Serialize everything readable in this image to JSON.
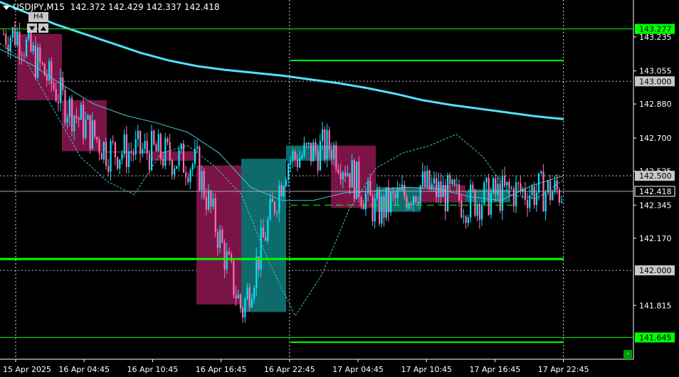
{
  "header": {
    "symbol_line": "USDJPY,M15",
    "ohlc": "142.372 142.429 142.337 142.418"
  },
  "timeframe": {
    "label": "H4"
  },
  "colors": {
    "background": "#000000",
    "bull_candle": "#00e5ff",
    "bear_candle": "#ff6fae",
    "bull_box": "#0f6b6b",
    "bear_box": "#7a1446",
    "ma_slow": "#4fe3ff",
    "ma_fast": "#40c8d0",
    "level_green": "#00ff00",
    "grid": "#c0c0c0"
  },
  "chart_data": {
    "type": "candlestick",
    "title": "USDJPY,M15",
    "ylim": [
      141.53,
      143.43
    ],
    "y_ticks": [
      143.235,
      143.055,
      142.88,
      142.7,
      142.525,
      142.345,
      142.17,
      141.815
    ],
    "x_ticks": [
      "15 Apr 2025",
      "16 Apr 04:45",
      "16 Apr 10:45",
      "16 Apr 16:45",
      "16 Apr 22:45",
      "17 Apr 04:45",
      "17 Apr 10:45",
      "17 Apr 16:45",
      "17 Apr 22:45"
    ],
    "price_labels": [
      {
        "text": "143.277",
        "value": 143.277,
        "style": "green"
      },
      {
        "text": "143.000",
        "value": 143.0,
        "style": "gray"
      },
      {
        "text": "142.500",
        "value": 142.5,
        "style": "gray"
      },
      {
        "text": "142.418",
        "value": 142.418,
        "style": "white"
      },
      {
        "text": "142.000",
        "value": 142.0,
        "style": "gray"
      },
      {
        "text": "141.645",
        "value": 141.645,
        "style": "green"
      }
    ],
    "h4_boxes": [
      {
        "open": 143.25,
        "close": 142.9,
        "dir": "bear"
      },
      {
        "open": 142.9,
        "close": 142.63,
        "dir": "bear"
      },
      {
        "open": 142.63,
        "close": 142.63,
        "dir": "bear"
      },
      {
        "open": 142.63,
        "close": 142.58,
        "dir": "bear"
      },
      {
        "open": 142.555,
        "close": 141.82,
        "dir": "bear"
      },
      {
        "open": 141.78,
        "close": 142.59,
        "dir": "bull"
      },
      {
        "open": 142.58,
        "close": 142.66,
        "dir": "bull"
      },
      {
        "open": 142.66,
        "close": 142.33,
        "dir": "bear"
      },
      {
        "open": 142.31,
        "close": 142.44,
        "dir": "bull"
      },
      {
        "open": 142.45,
        "close": 142.36,
        "dir": "bear"
      },
      {
        "open": 142.36,
        "close": 142.418,
        "dir": "bull"
      }
    ],
    "levels": [
      {
        "value": 143.277,
        "kind": "thin"
      },
      {
        "value": 143.11,
        "kind": "segment"
      },
      {
        "value": 142.06,
        "kind": "thick"
      },
      {
        "value": 141.645,
        "kind": "thin"
      },
      {
        "value": 141.62,
        "kind": "segment"
      },
      {
        "value": 142.345,
        "kind": "dashed"
      }
    ],
    "ma_slow_values": [
      143.42,
      143.36,
      143.3,
      143.25,
      143.2,
      143.15,
      143.11,
      143.08,
      143.06,
      143.045,
      143.03,
      143.01,
      142.99,
      142.965,
      142.935,
      142.9,
      142.875,
      142.855,
      142.835,
      142.815,
      142.8
    ],
    "ma_fast_values": [
      143.17,
      143.09,
      142.98,
      142.88,
      142.82,
      142.78,
      142.73,
      142.62,
      142.44,
      142.37,
      142.37,
      142.41,
      142.42,
      142.44,
      142.43,
      142.39,
      142.37,
      142.45,
      142.5
    ],
    "ma_dashed_values": [
      143.2,
      143.1,
      142.85,
      142.6,
      142.47,
      142.4,
      142.62,
      142.66,
      142.55,
      142.4,
      142.05,
      141.76,
      141.98,
      142.32,
      142.54,
      142.62,
      142.66,
      142.72,
      142.6,
      142.4,
      142.38,
      142.48
    ],
    "last_price": 142.418
  },
  "corner_button": {
    "label": "-"
  }
}
